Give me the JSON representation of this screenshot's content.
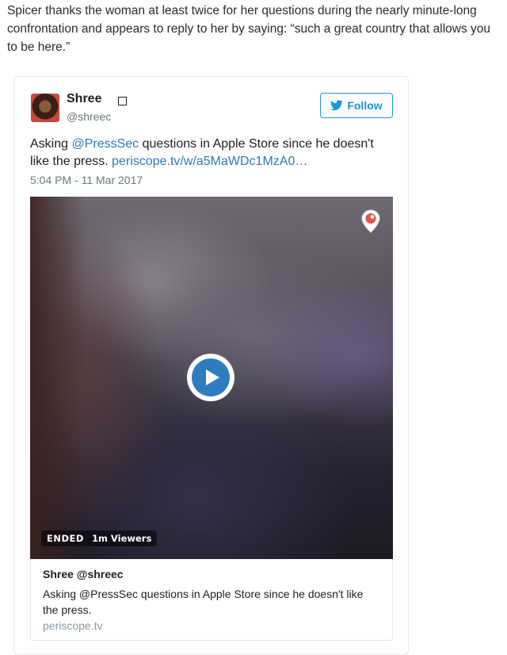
{
  "article": {
    "paragraph": "Spicer thanks the woman at least twice for her questions during the nearly minute-long confrontation and appears to reply to her by saying: “such a great country that allows you to be here.”"
  },
  "tweet": {
    "author_name": "Shree",
    "author_handle": "@shreec",
    "follow_label": "Follow",
    "text_prefix": "Asking ",
    "mention": "@PressSec",
    "text_middle": " questions in Apple Store since he doesn't like the press. ",
    "link": "periscope.tv/w/a5MaWDc1MzA0…",
    "timestamp": "5:04 PM - 11 Mar 2017",
    "icons": {
      "follow": "twitter-bird-icon",
      "badge": "square-badge-icon",
      "video_overlay": "periscope-icon",
      "play": "play-icon"
    },
    "colors": {
      "link": "#2b7bb9",
      "follow": "#1b95e0",
      "play": "#2f7dbf"
    }
  },
  "video": {
    "status": "ENDED",
    "viewers": "1m Viewers"
  },
  "card": {
    "title": "Shree @shreec",
    "description": "Asking @PressSec questions in Apple Store since he doesn't like the press.",
    "domain": "periscope.tv"
  }
}
